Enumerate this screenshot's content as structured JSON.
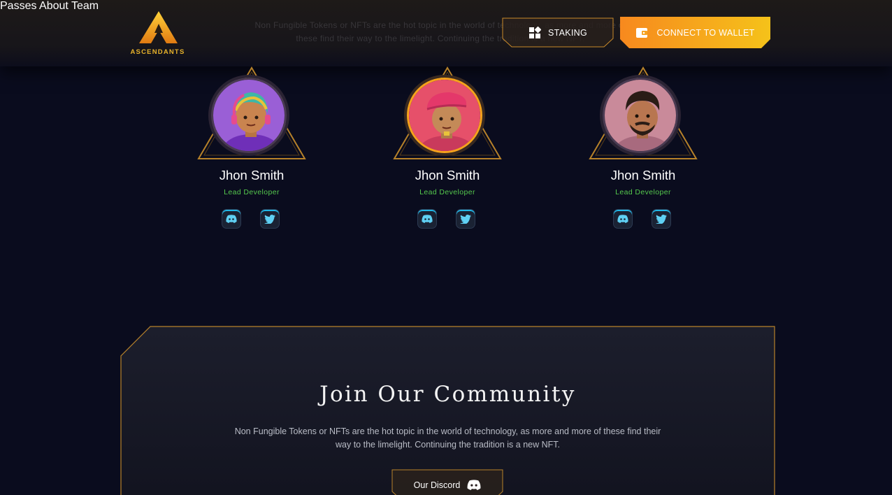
{
  "header": {
    "brand": "ASCENDANTS",
    "ghost_text": "Non Fungible Tokens or NFTs are the hot topic in the world of technology, as more and more of these find their way to the limelight. Continuing the tradition is a new NFT.",
    "nav": [
      {
        "label": "Passes"
      },
      {
        "label": "About"
      },
      {
        "label": "Team"
      }
    ],
    "staking_label": "STAKING",
    "connect_label": "CONNECT TO WALLET"
  },
  "team": [
    {
      "name": "Jhon Smith",
      "role": "Lead Developer"
    },
    {
      "name": "Jhon Smith",
      "role": "Lead Developer"
    },
    {
      "name": "Jhon Smith",
      "role": "Lead Developer"
    }
  ],
  "community": {
    "title": "Join Our Community",
    "description": "Non Fungible Tokens or NFTs are the hot topic in the world of technology, as more and more of these find their way to the limelight. Continuing the tradition is a new NFT.",
    "button_label": "Our Discord"
  },
  "colors": {
    "accent_gold": "#f0a928",
    "accent_green": "#55c94d",
    "accent_cyan": "#1fb6e6",
    "background": "#0a0c1e"
  },
  "icons": [
    "logo-a-icon",
    "staking-grid-icon",
    "wallet-icon",
    "discord-icon",
    "twitter-icon"
  ]
}
